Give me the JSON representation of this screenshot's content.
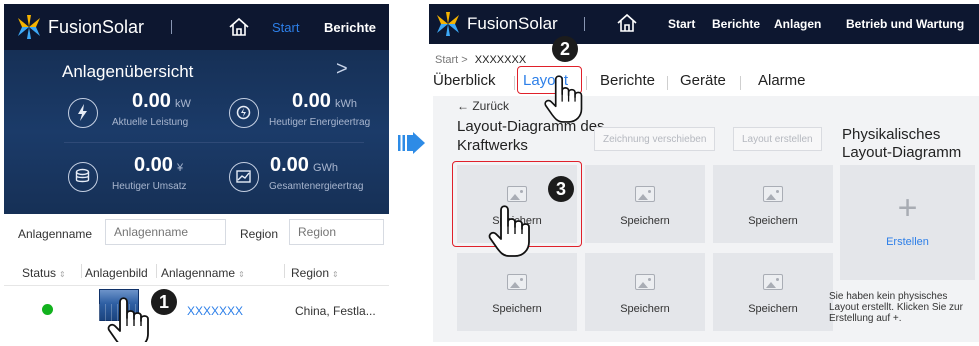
{
  "left": {
    "brand": "FusionSolar",
    "nav": {
      "start": "Start",
      "berichte": "Berichte"
    },
    "overview": {
      "title": "Anlagenübersicht",
      "arrow": ">",
      "kpis": [
        {
          "value": "0.00",
          "unit": "kW",
          "label": "Aktuelle Leistung",
          "icon": "lightning-icon"
        },
        {
          "value": "0.00",
          "unit": "kWh",
          "label": "Heutiger Energieertrag",
          "icon": "energy-icon"
        },
        {
          "value": "0.00",
          "unit": "¥",
          "label": "Heutiger Umsatz",
          "icon": "coins-icon"
        },
        {
          "value": "0.00",
          "unit": "GWh",
          "label": "Gesamtenergieertrag",
          "icon": "chart-icon"
        }
      ]
    },
    "filters": {
      "name_label": "Anlagenname",
      "name_placeholder": "Anlagenname",
      "region_label": "Region",
      "region_placeholder": "Region"
    },
    "table": {
      "headers": [
        "Status",
        "Anlagenbild",
        "Anlagenname",
        "Region"
      ],
      "rows": [
        {
          "status_color": "#12b21e",
          "name": "XXXXXXX",
          "region": "China, Festla..."
        }
      ]
    }
  },
  "right": {
    "brand": "FusionSolar",
    "nav": [
      "Start",
      "Berichte",
      "Anlagen",
      "Betrieb und Wartung"
    ],
    "breadcrumb": {
      "root": "Start",
      "separator": ">",
      "current": "XXXXXXX"
    },
    "tabs": [
      "Überblick",
      "Layout",
      "Berichte",
      "Geräte",
      "Alarme"
    ],
    "active_tab": "Layout",
    "back_label": "← Zurück",
    "layout_title": "Layout-Diagramm des Kraftwerks",
    "buttons": {
      "move": "Zeichnung verschieben",
      "create_layout": "Layout erstellen"
    },
    "physical_title": "Physikalisches Layout-Diagramm",
    "cards": [
      "Speichern",
      "Speichern",
      "Speichern",
      "Speichern",
      "Speichern",
      "Speichern"
    ],
    "create_label": "Erstellen",
    "create_icon": "plus-icon",
    "no_layout_msg": "Sie haben kein physisches Layout erstellt. Klicken Sie zur Erstellung auf +."
  },
  "steps": [
    "1",
    "2",
    "3"
  ],
  "colors": {
    "navbar": "#0d1730",
    "accent": "#2d7fe8",
    "highlight": "#e0202a",
    "status_ok": "#12b21e"
  }
}
